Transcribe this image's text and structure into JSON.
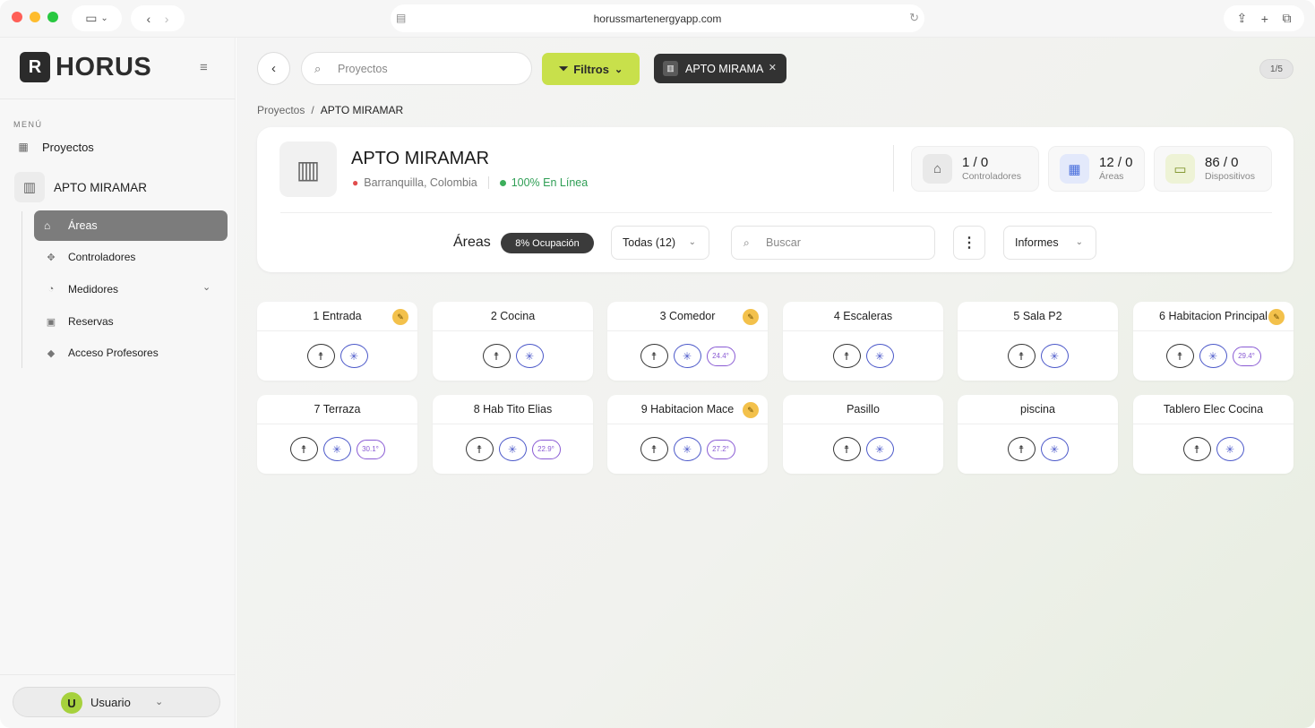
{
  "browser": {
    "url": "horussmartenergyapp.com"
  },
  "sidebar": {
    "logo_text": "HORUS",
    "menu_label": "MENÚ",
    "projects_label": "Proyectos",
    "current_project": "APTO MIRAMAR",
    "items": [
      {
        "label": "Áreas",
        "icon": "areas-icon"
      },
      {
        "label": "Controladores",
        "icon": "controllers-icon"
      },
      {
        "label": "Medidores",
        "icon": "meter-icon"
      },
      {
        "label": "Reservas",
        "icon": "calendar-icon"
      },
      {
        "label": "Acceso Profesores",
        "icon": "graduation-icon"
      }
    ],
    "user": {
      "initial": "U",
      "name": "Usuario"
    }
  },
  "topbar": {
    "search_placeholder": "Proyectos",
    "filters_label": "Filtros",
    "chip_label": "APTO MIRAMA",
    "pager": "1/5"
  },
  "breadcrumb": {
    "root": "Proyectos",
    "separator": "/",
    "current": "APTO MIRAMAR"
  },
  "project": {
    "title": "APTO MIRAMAR",
    "location": "Barranquilla, Colombia",
    "status": "100% En Línea",
    "stats": [
      {
        "value": "1 / 0",
        "label": "Controladores",
        "color": "#e9e9e9"
      },
      {
        "value": "12 / 0",
        "label": "Áreas",
        "color": "#e3e9fb"
      },
      {
        "value": "86 / 0",
        "label": "Dispositivos",
        "color": "#eef3d6"
      }
    ]
  },
  "areas_bar": {
    "title": "Áreas",
    "occupancy": "8% Ocupación",
    "filter_value": "Todas (12)",
    "search_placeholder": "Buscar",
    "reports_label": "Informes"
  },
  "areas": [
    {
      "name": "1 Entrada",
      "maintenance": true,
      "temp": ""
    },
    {
      "name": "2 Cocina",
      "maintenance": false,
      "temp": ""
    },
    {
      "name": "3 Comedor",
      "maintenance": true,
      "temp": "24.4°"
    },
    {
      "name": "4 Escaleras",
      "maintenance": false,
      "temp": ""
    },
    {
      "name": "5 Sala P2",
      "maintenance": false,
      "temp": ""
    },
    {
      "name": "6 Habitacion Principal",
      "maintenance": true,
      "temp": "29.4°"
    },
    {
      "name": "7 Terraza",
      "maintenance": false,
      "temp": "30.1°"
    },
    {
      "name": "8 Hab Tito Elias",
      "maintenance": false,
      "temp": "22.9°"
    },
    {
      "name": "9 Habitacion Mace",
      "maintenance": true,
      "temp": "27.2°"
    },
    {
      "name": "Pasillo",
      "maintenance": false,
      "temp": ""
    },
    {
      "name": "piscina",
      "maintenance": false,
      "temp": ""
    },
    {
      "name": "Tablero Elec Cocina",
      "maintenance": false,
      "temp": ""
    }
  ]
}
